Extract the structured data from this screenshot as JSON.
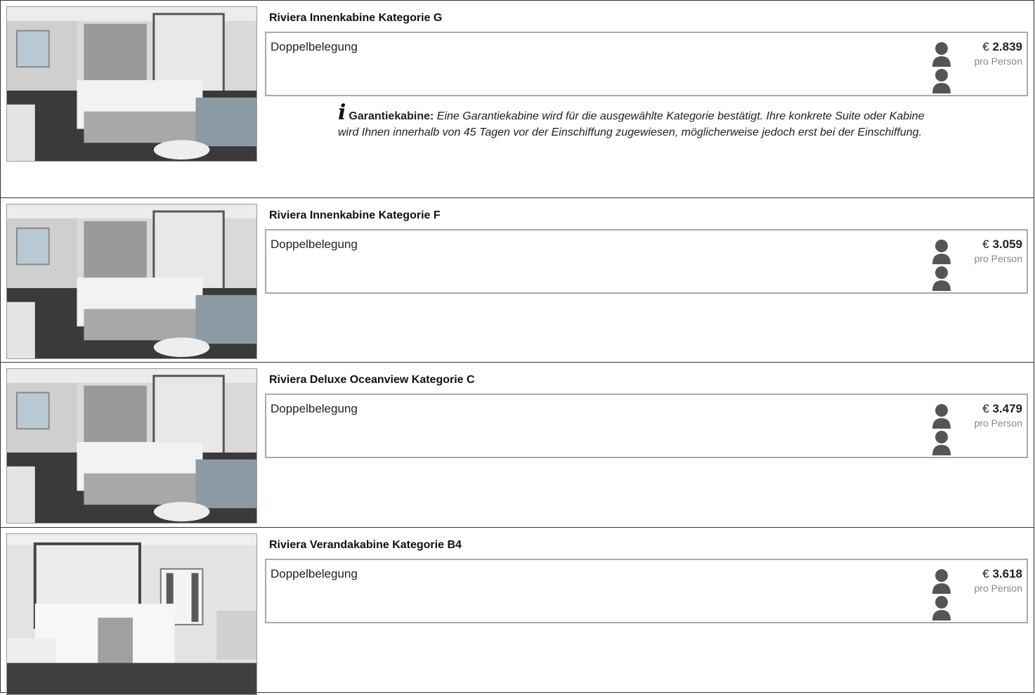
{
  "cabins": [
    {
      "title": "Riviera Innenkabine Kategorie G",
      "occupancy": "Doppelbelegung",
      "price_currency": "€",
      "price_amount": "2.839",
      "price_sub": "pro Person",
      "guarantee": {
        "icon": "info-icon",
        "icon_glyph": "i",
        "label": "Garantiekabine:",
        "text": "Eine Garantiekabine wird für die ausgewählte Kategorie bestätigt. Ihre konkrete Suite oder Kabine wird Ihnen innerhalb von 45 Tagen vor der Einschiffung zugewiesen, möglicherweise jedoch erst bei der Einschiffung."
      }
    },
    {
      "title": "Riviera Innenkabine Kategorie F",
      "occupancy": "Doppelbelegung",
      "price_currency": "€",
      "price_amount": "3.059",
      "price_sub": "pro Person"
    },
    {
      "title": "Riviera Deluxe Oceanview Kategorie C",
      "occupancy": "Doppelbelegung",
      "price_currency": "€",
      "price_amount": "3.479",
      "price_sub": "pro Person"
    },
    {
      "title": "Riviera Verandakabine Kategorie B4",
      "occupancy": "Doppelbelegung",
      "price_currency": "€",
      "price_amount": "3.618",
      "price_sub": "pro Person"
    }
  ],
  "colors": {
    "person_icon": "#555555",
    "border": "#aaaaaa"
  }
}
